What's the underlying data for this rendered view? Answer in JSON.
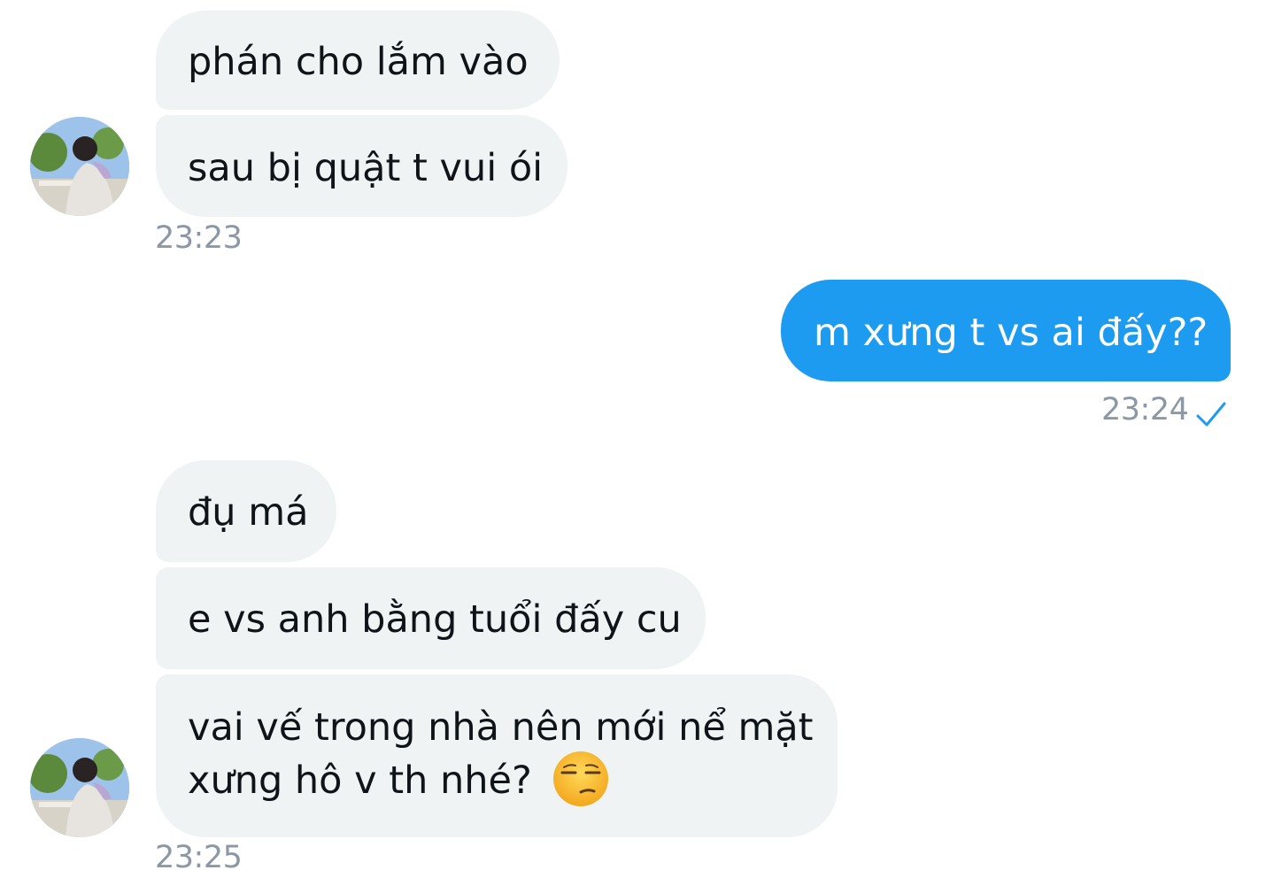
{
  "messages": {
    "group1": {
      "bubble1": "phán cho lắm vào",
      "bubble2": "sau bị quật t vui ói",
      "time": "23:23"
    },
    "outgoing": {
      "bubble": "m xưng t vs ai đấy??",
      "time": "23:24",
      "status_icon": "sent-check-icon"
    },
    "group2": {
      "bubble1": "đụ má",
      "bubble2": "e vs anh bằng tuổi đấy cu",
      "bubble3_line1": "vai vế trong nhà nên mới nể mặt",
      "bubble3_line2": "xưng hô v th nhé?",
      "bubble3_emoji": "unamused-face-emoji",
      "time": "23:25"
    }
  },
  "colors": {
    "incoming_bubble": "#eff3f4",
    "outgoing_bubble": "#1d9bf0",
    "timestamp": "#8b98a5",
    "check": "#1d9bf0"
  }
}
